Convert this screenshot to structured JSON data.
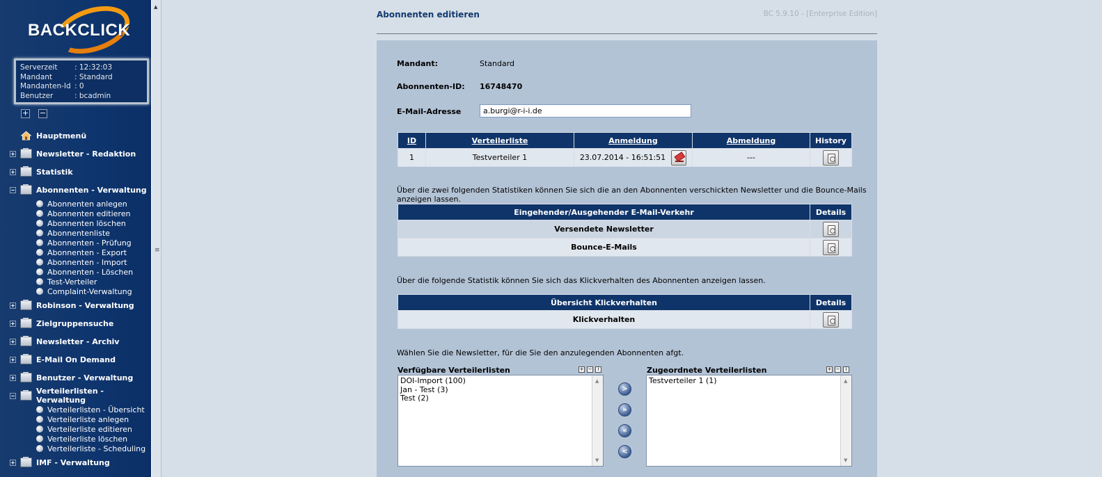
{
  "sidebar": {
    "logo_text": "BACKCLICK",
    "info": [
      {
        "key": "Serverzeit",
        "value": ": 12:32:03"
      },
      {
        "key": "Mandant",
        "value": ": Standard"
      },
      {
        "key": "Mandanten-Id",
        "value": ": 0"
      },
      {
        "key": "Benutzer",
        "value": ": bcadmin"
      }
    ],
    "expand_all": "+",
    "collapse_all": "−",
    "main_menu": "Hauptmenü",
    "sections": [
      {
        "label": "Newsletter - Redaktion",
        "state": "+"
      },
      {
        "label": "Statistik",
        "state": "+"
      },
      {
        "label": "Abonnenten - Verwaltung",
        "state": "−",
        "items": [
          "Abonnenten anlegen",
          "Abonnenten editieren",
          "Abonnenten löschen",
          "Abonnentenliste",
          "Abonnenten - Prüfung",
          "Abonnenten - Export",
          "Abonnenten - Import",
          "Abonnenten - Löschen",
          "Test-Verteiler",
          "Complaint-Verwaltung"
        ]
      },
      {
        "label": "Robinson - Verwaltung",
        "state": "+"
      },
      {
        "label": "Zielgruppensuche",
        "state": "+"
      },
      {
        "label": "Newsletter - Archiv",
        "state": "+"
      },
      {
        "label": "E-Mail On Demand",
        "state": "+"
      },
      {
        "label": "Benutzer - Verwaltung",
        "state": "+"
      },
      {
        "label": "Verteilerlisten - Verwaltung",
        "state": "−",
        "items": [
          "Verteilerlisten - Übersicht",
          "Verteilerliste anlegen",
          "Verteilerliste editieren",
          "Verteilerliste löschen",
          "Verteilerliste - Scheduling"
        ]
      },
      {
        "label": "IMF - Verwaltung",
        "state": "+"
      }
    ]
  },
  "header": {
    "title": "Abonnenten editieren",
    "version": "BC 5.9.10 - [Enterprise Edition]"
  },
  "form": {
    "mandant_label": "Mandant:",
    "mandant_value": "Standard",
    "id_label": "Abonnenten-ID:",
    "id_value": "16748470",
    "email_label": "E-Mail-Adresse",
    "email_value": "a.burgi@r-i-i.de"
  },
  "subscriptions": {
    "headers": [
      "ID",
      "Verteilerliste",
      "Anmeldung",
      "Abmeldung",
      "History"
    ],
    "rows": [
      {
        "id": "1",
        "list": "Testverteiler 1",
        "anmeldung": "23.07.2014 - 16:51:51",
        "abmeldung": "---"
      }
    ]
  },
  "stats_intro": "Über die zwei folgenden Statistiken können Sie sich die an den Abonnenten verschickten Newsletter und die Bounce-Mails anzeigen lassen.",
  "traffic": {
    "header": "Eingehender/Ausgehender E-Mail-Verkehr",
    "details": "Details",
    "rows": [
      "Versendete Newsletter",
      "Bounce-E-Mails"
    ]
  },
  "click_intro": "Über die folgende Statistik können Sie sich das Klickverhalten des Abonnenten anzeigen lassen.",
  "click": {
    "header": "Übersicht Klickverhalten",
    "details": "Details",
    "rows": [
      "Klickverhalten"
    ]
  },
  "lists_intro": "Wählen Sie die Newsletter, für die Sie den anzulegenden Abonnenten afgt.",
  "available": {
    "title": "Verfügbare Verteilerlisten",
    "items": [
      "DOI-Import (100)",
      "Jan - Test (3)",
      "Test (2)"
    ]
  },
  "assigned": {
    "title": "Zugeordnete Verteilerlisten",
    "items": [
      "Testverteiler 1 (1)"
    ]
  },
  "move_buttons": [
    ">",
    "»",
    "«",
    "<"
  ]
}
